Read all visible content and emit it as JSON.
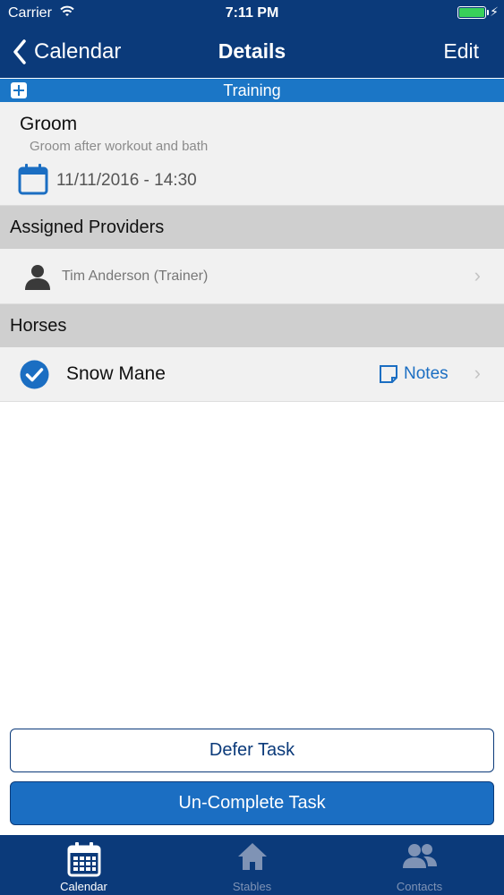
{
  "status_bar": {
    "carrier": "Carrier",
    "time": "7:11 PM",
    "wifi_icon": "wifi-icon",
    "battery_icon": "battery-icon",
    "battery_color": "#38d05a"
  },
  "nav": {
    "back_label": "Calendar",
    "title": "Details",
    "edit_label": "Edit"
  },
  "category": {
    "label": "Training",
    "icon": "plus-square-icon"
  },
  "task": {
    "name": "Groom",
    "description": "Groom after workout and bath",
    "datetime": "11/11/2016 - 14:30",
    "icon": "calendar-icon"
  },
  "assigned_providers": {
    "header": "Assigned Providers",
    "items": [
      {
        "name": "Tim Anderson (Trainer)",
        "icon": "person-icon"
      }
    ]
  },
  "horses": {
    "header": "Horses",
    "items": [
      {
        "name": "Snow Mane",
        "checked": true,
        "notes_label": "Notes",
        "icon": "checkmark-circle-icon"
      }
    ]
  },
  "actions": {
    "defer_label": "Defer Task",
    "uncomplete_label": "Un-Complete Task"
  },
  "tabbar": {
    "items": [
      {
        "label": "Calendar",
        "icon": "calendar-grid-icon",
        "active": true
      },
      {
        "label": "Stables",
        "icon": "home-icon",
        "active": false
      },
      {
        "label": "Contacts",
        "icon": "people-icon",
        "active": false
      }
    ]
  },
  "colors": {
    "navy": "#0b3a7a",
    "accent_blue": "#1b76c6",
    "button_blue": "#1b6ec2",
    "row_bg": "#f1f1f1",
    "section_bg": "#cfcfcf"
  }
}
